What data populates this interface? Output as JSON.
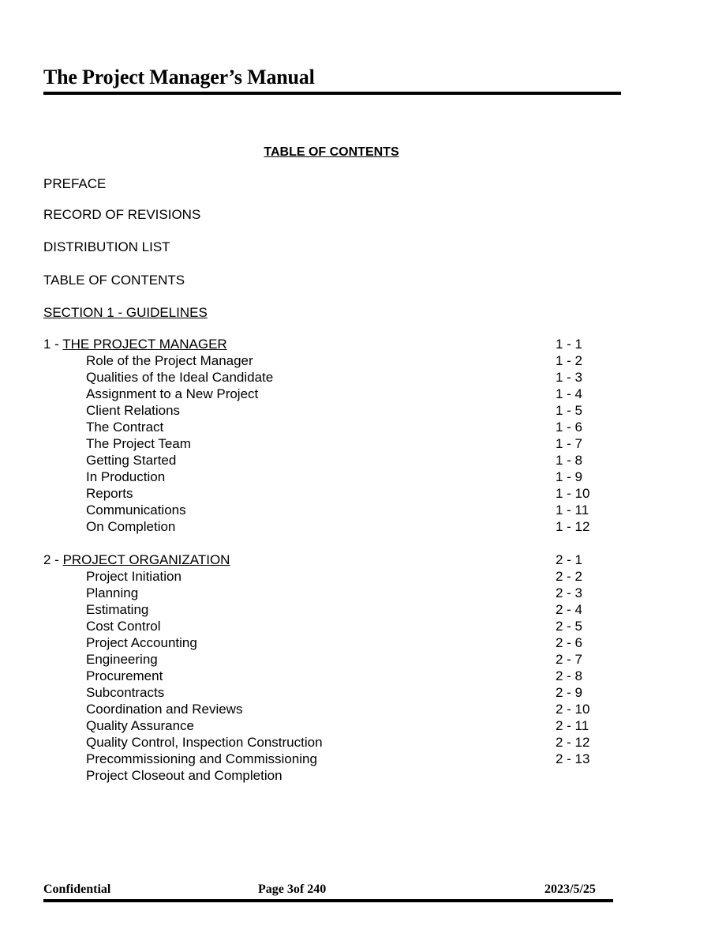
{
  "header": {
    "title": "The Project Manager’s Manual"
  },
  "toc_title": "TABLE OF CONTENTS",
  "front_matter": [
    "PREFACE",
    "RECORD OF REVISIONS",
    "DISTRIBUTION LIST",
    "TABLE OF CONTENTS"
  ],
  "section_heading": "SECTION 1 - GUIDELINES",
  "chapters": [
    {
      "number": "1 - ",
      "title": "THE PROJECT MANAGER",
      "page": "1 - 1",
      "entries": [
        {
          "label": "Role of the Project Manager",
          "page": "1 - 2"
        },
        {
          "label": "Qualities of the Ideal Candidate",
          "page": "1 - 3"
        },
        {
          "label": "Assignment to a New Project",
          "page": "1 - 4"
        },
        {
          "label": "Client Relations",
          "page": "1 - 5"
        },
        {
          "label": "The Contract",
          "page": "1 - 6"
        },
        {
          "label": "The Project Team",
          "page": "1 - 7"
        },
        {
          "label": "Getting Started",
          "page": "1 - 8"
        },
        {
          "label": "In Production",
          "page": "1 - 9"
        },
        {
          "label": "Reports",
          "page": "1 - 10"
        },
        {
          "label": "Communications",
          "page": "1 - 11"
        },
        {
          "label": "On Completion",
          "page": "1 - 12"
        }
      ]
    },
    {
      "number": "2 - ",
      "title": "PROJECT ORGANIZATION",
      "page": "2 - 1",
      "entries": [
        {
          "label": "Project Initiation",
          "page": "2 - 2"
        },
        {
          "label": "Planning",
          "page": "2 - 3"
        },
        {
          "label": "Estimating",
          "page": "2 - 4"
        },
        {
          "label": "Cost Control",
          "page": "2 - 5"
        },
        {
          "label": "Project Accounting",
          "page": "2 - 6"
        },
        {
          "label": "Engineering",
          "page": "2 - 7"
        },
        {
          "label": "Procurement",
          "page": "2 - 8"
        },
        {
          "label": "Subcontracts",
          "page": "2 - 9"
        },
        {
          "label": "Coordination and Reviews",
          "page": "2 - 10"
        },
        {
          "label": "Quality Assurance",
          "page": "2 - 11"
        },
        {
          "label": "Quality Control, Inspection Construction",
          "page": "2 - 12"
        },
        {
          "label": "Precommissioning and Commissioning",
          "page": "2 - 13"
        },
        {
          "label": "Project Closeout and Completion",
          "page": ""
        }
      ]
    }
  ],
  "footer": {
    "left": "Confidential",
    "center": "Page 3of 240",
    "right": "2023/5/25"
  }
}
